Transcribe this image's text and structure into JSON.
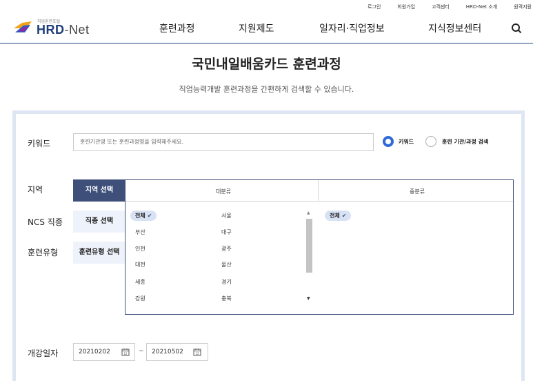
{
  "header": {
    "top_links": [
      "로그인",
      "회원가입",
      "고객센터",
      "HRD-Net 소개",
      "원격지원"
    ],
    "logo_small": "직업훈련포털",
    "logo_main": "HRD",
    "logo_dash": "-",
    "logo_suffix": "Net",
    "nav": [
      "훈련과정",
      "지원제도",
      "일자리·직업정보",
      "지식정보센터"
    ],
    "search_icon": "search-icon"
  },
  "page": {
    "title": "국민내일배움카드 훈련과정",
    "description": "직업능력개발 훈련과정을 간편하게 검색할 수 있습니다."
  },
  "form": {
    "keyword_label": "키워드",
    "keyword_placeholder": "훈련기관명 또는 훈련과정명을 입력해주세요.",
    "radio_keyword": "키워드",
    "radio_institution": "훈련 기관/과정 검색",
    "radio_selected": "키워드",
    "region_label": "지역",
    "region_button": "지역 선택",
    "ncs_label": "NCS 직종",
    "ncs_button": "직종 선택",
    "type_label": "훈련유형",
    "type_button": "훈련유형 선택",
    "date_label": "개강일자",
    "date_start": "20210202",
    "date_end": "20210502",
    "date_separator": "~"
  },
  "region_popup": {
    "major_header": "대분류",
    "minor_header": "중분류",
    "major_col1": [
      "전체",
      "부산",
      "인천",
      "대전",
      "세종",
      "강원"
    ],
    "major_col2": [
      "서울",
      "대구",
      "광주",
      "울산",
      "경기",
      "충북"
    ],
    "selected_major": "전체",
    "minor_items": [
      "전체"
    ],
    "selected_minor": "전체"
  },
  "colors": {
    "brand": "#1d3d7a",
    "tab_active": "#3e4f7a",
    "tab_idle": "#eef2fb",
    "chip": "#d9e2f5",
    "radio": "#2f6ad8",
    "panel_border": "#dfe6f3"
  }
}
